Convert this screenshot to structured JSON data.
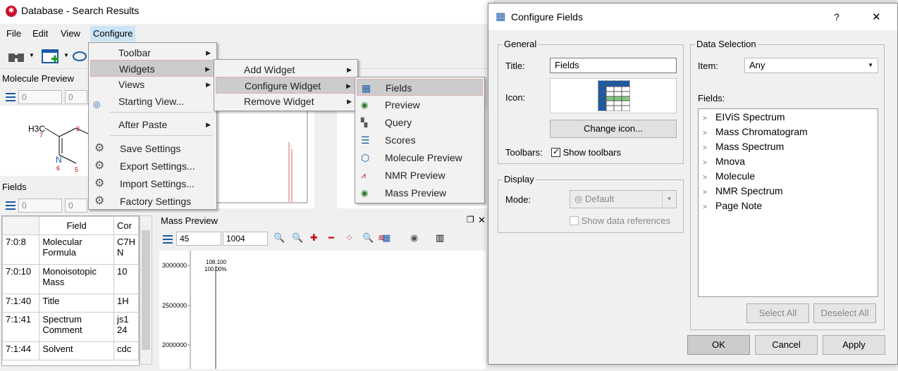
{
  "window": {
    "title": "Database - Search Results",
    "app_icon": "mnova-logo"
  },
  "menubar": [
    "File",
    "Edit",
    "View",
    "Configure"
  ],
  "molecule_preview": {
    "title": "Molecule Preview",
    "spin1": "0",
    "spin2": "0",
    "atoms": {
      "methyl": "H3C",
      "n7": "7",
      "n2": "2",
      "N": "N",
      "n6": "6",
      "n5": "5"
    }
  },
  "fields_panel": {
    "title": "Fields",
    "spin1": "0",
    "spin2": "0",
    "columns": [
      "Field",
      "Cor"
    ],
    "rows": [
      {
        "id": "7:0:8",
        "field": "Molecular Formula",
        "value": "C7H N"
      },
      {
        "id": "7:0:10",
        "field": "Monoisotopic Mass",
        "value": "10"
      },
      {
        "id": "7:1:40",
        "field": "Title",
        "value": "1H"
      },
      {
        "id": "7:1:41",
        "field": "Spectrum Comment",
        "value": "js1 24"
      },
      {
        "id": "7:1:44",
        "field": "Solvent",
        "value": "cdc"
      }
    ]
  },
  "mass_preview": {
    "title": "Mass Preview",
    "spin_from": "45",
    "spin_to": "1004",
    "peak_label": "108.100",
    "peak_pct": "100.00%",
    "y_ticks": [
      "3000000",
      "2500000",
      "2000000"
    ]
  },
  "configure_menu": {
    "items": [
      {
        "label": "Toolbar",
        "submenu": true
      },
      {
        "label": "Widgets",
        "submenu": true,
        "selected": true
      },
      {
        "label": "Views",
        "submenu": true
      },
      {
        "label": "Starting View...",
        "submenu": false
      },
      {
        "label": "After Paste",
        "submenu": true
      },
      {
        "label": "Save Settings",
        "submenu": false
      },
      {
        "label": "Export Settings...",
        "submenu": false
      },
      {
        "label": "Import Settings...",
        "submenu": false
      },
      {
        "label": "Factory Settings",
        "submenu": false
      }
    ]
  },
  "widgets_menu": {
    "items": [
      "Add Widget",
      "Configure Widget",
      "Remove Widget"
    ],
    "selected": "Configure Widget"
  },
  "configure_widget_menu": {
    "items": [
      "Fields",
      "Preview",
      "Query",
      "Scores",
      "Molecule Preview",
      "NMR Preview",
      "Mass Preview"
    ],
    "selected": "Fields"
  },
  "dialog": {
    "title": "Configure Fields",
    "help": "?",
    "close": "✕",
    "general": {
      "label": "General",
      "title_label": "Title:",
      "title_value": "Fields",
      "icon_label": "Icon:",
      "change_icon": "Change icon...",
      "toolbars_label": "Toolbars:",
      "show_toolbars": "Show toolbars",
      "show_toolbars_checked": true
    },
    "display": {
      "label": "Display",
      "mode_label": "Mode:",
      "mode_value": "Default",
      "show_refs": "Show data references"
    },
    "data_selection": {
      "label": "Data Selection",
      "item_label": "Item:",
      "item_value": "Any",
      "fields_label": "Fields:",
      "tree": [
        "EIViS Spectrum",
        "Mass Chromatogram",
        "Mass Spectrum",
        "Mnova",
        "Molecule",
        "NMR Spectrum",
        "Page Note"
      ],
      "select_all": "Select All",
      "deselect_all": "Deselect All"
    },
    "buttons": {
      "ok": "OK",
      "cancel": "Cancel",
      "apply": "Apply"
    }
  },
  "colors": {
    "accent": "#1a5aa6",
    "menu_selected": "#cccccc",
    "brand": "#c8102e"
  }
}
